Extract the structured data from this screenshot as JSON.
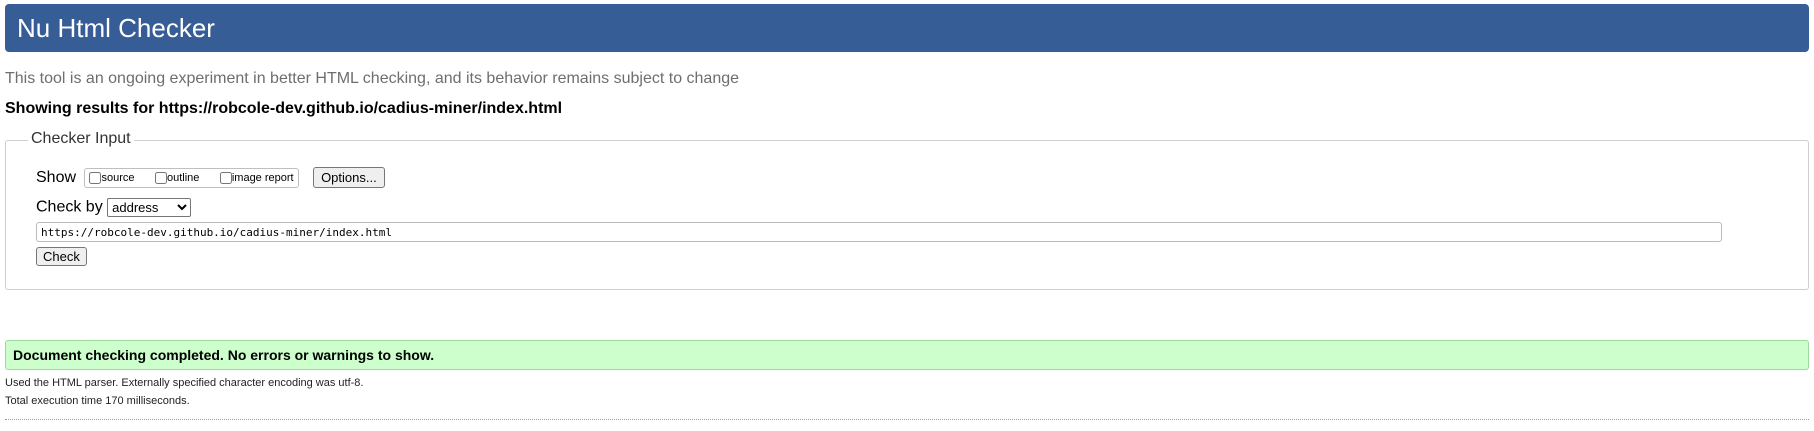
{
  "header": {
    "title": "Nu Html Checker"
  },
  "intro": "This tool is an ongoing experiment in better HTML checking, and its behavior remains subject to change",
  "results_for": "Showing results for https://robcole-dev.github.io/cadius-miner/index.html",
  "checker_input": {
    "legend": "Checker Input",
    "show_label": "Show",
    "show_options": [
      {
        "label": "source",
        "checked": false
      },
      {
        "label": "outline",
        "checked": false
      },
      {
        "label": "image report",
        "checked": false
      }
    ],
    "options_button": "Options...",
    "check_by_label": "Check by",
    "check_by_selected": "address",
    "url_value": "https://robcole-dev.github.io/cadius-miner/index.html",
    "check_button": "Check"
  },
  "result": {
    "message": "Document checking completed. No errors or warnings to show.",
    "parser_info": "Used the HTML parser. Externally specified character encoding was utf-8.",
    "execution_time": "Total execution time 170 milliseconds."
  },
  "colors": {
    "header_bg": "#365d95",
    "success_bg": "#ccffcc"
  }
}
